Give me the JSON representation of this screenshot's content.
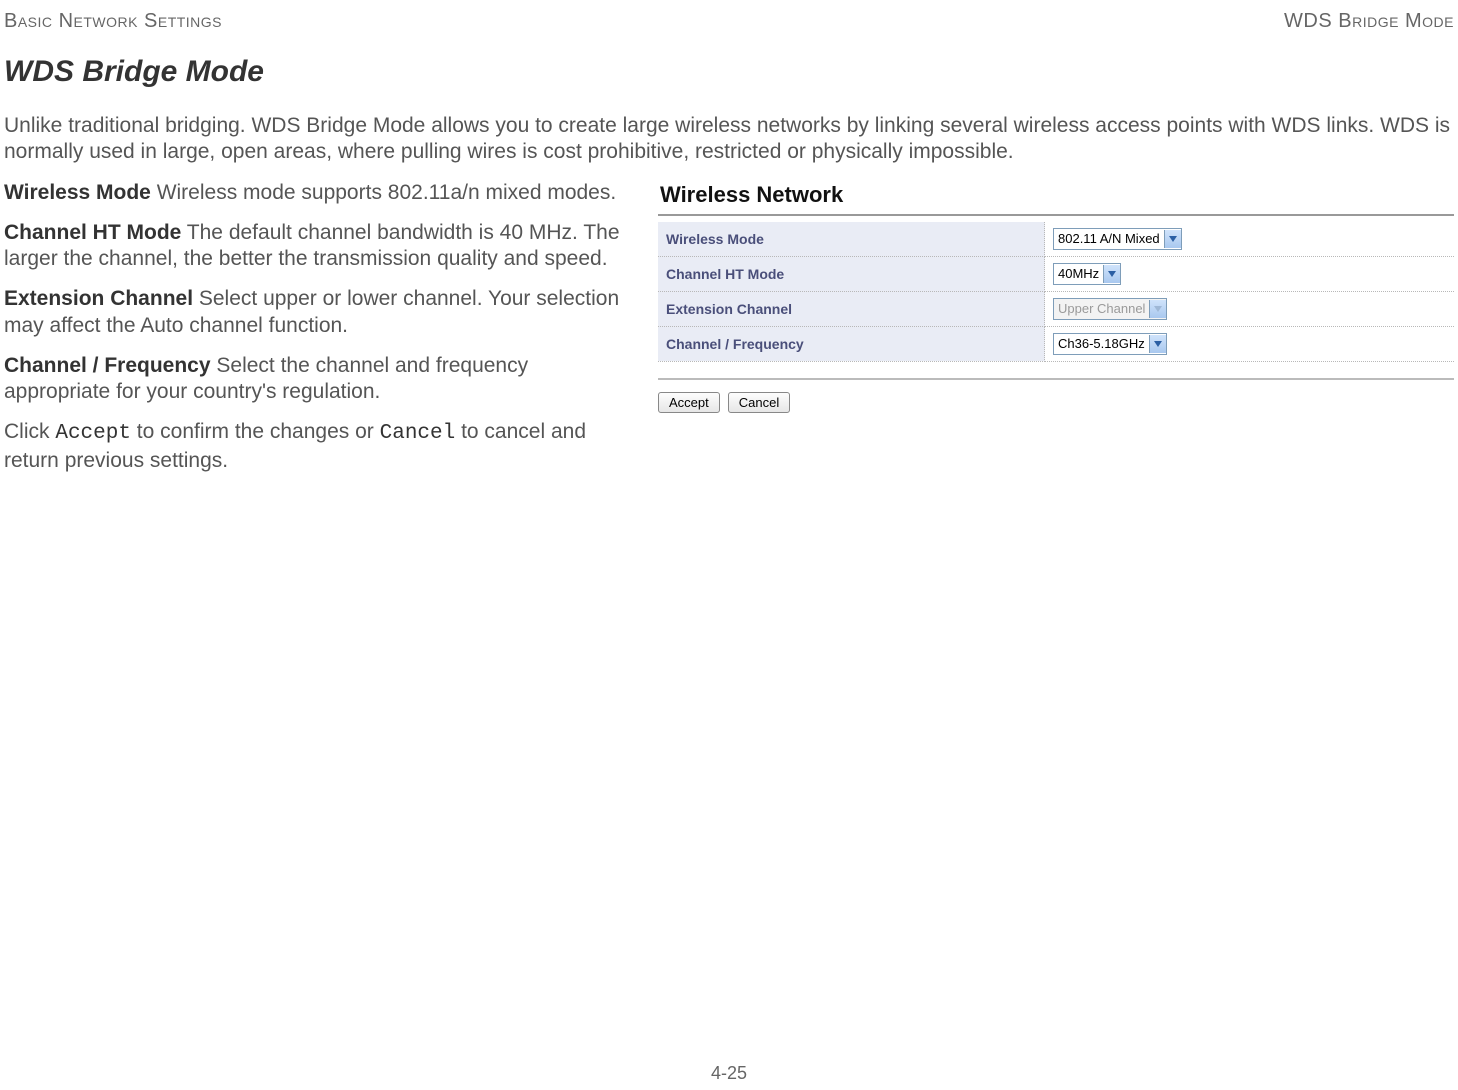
{
  "header": {
    "left": "Basic Network Settings",
    "right": "WDS Bridge Mode"
  },
  "title": "WDS Bridge Mode",
  "intro": "Unlike traditional bridging. WDS Bridge Mode allows you to create large wireless networks by linking several wireless access points with WDS links. WDS is normally used in large, open areas, where pulling wires is cost prohibitive, restricted or physically impossible.",
  "paragraphs": {
    "wireless_mode": {
      "label": "Wireless Mode",
      "text": "  Wireless mode supports 802.11a/n mixed modes."
    },
    "channel_ht_mode": {
      "label": "Channel HT Mode",
      "text": "  The default channel bandwidth is 40 MHz. The larger the channel, the better the transmission quality and speed."
    },
    "extension_channel": {
      "label": "Extension Channel",
      "text": "  Select upper or lower channel. Your selection may affect the Auto channel function."
    },
    "channel_frequency": {
      "label": "Channel / Frequency",
      "text": "  Select the channel and frequency appropriate for your country's regulation."
    },
    "click_line": {
      "pre": "Click ",
      "accept": "Accept",
      "mid": " to confirm the changes or ",
      "cancel": "Cancel",
      "post": " to cancel and return previous settings."
    }
  },
  "panel": {
    "title": "Wireless Network",
    "rows": {
      "wireless_mode": {
        "label": "Wireless Mode",
        "value": "802.11 A/N Mixed"
      },
      "channel_ht_mode": {
        "label": "Channel HT Mode",
        "value": "40MHz"
      },
      "extension_channel": {
        "label": "Extension Channel",
        "value": "Upper Channel",
        "disabled": true
      },
      "channel_frequency": {
        "label": "Channel / Frequency",
        "value": "Ch36-5.18GHz"
      }
    },
    "buttons": {
      "accept": "Accept",
      "cancel": "Cancel"
    }
  },
  "page_number": "4-25"
}
